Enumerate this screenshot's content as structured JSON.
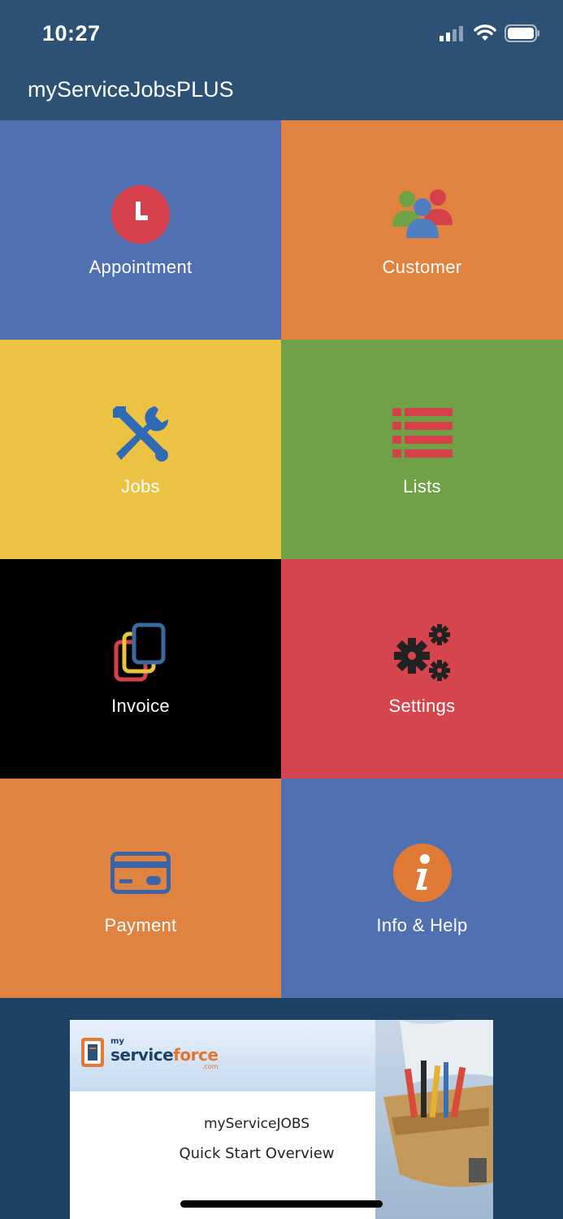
{
  "status": {
    "time": "10:27"
  },
  "header": {
    "title": "myServiceJobsPLUS"
  },
  "tiles": [
    {
      "label": "Appointment",
      "color": "#5170b2",
      "icon": "clock-icon"
    },
    {
      "label": "Customer",
      "color": "#e08240",
      "icon": "people-icon"
    },
    {
      "label": "Jobs",
      "color": "#ecc242",
      "icon": "tools-icon"
    },
    {
      "label": "Lists",
      "color": "#6fa247",
      "icon": "list-icon"
    },
    {
      "label": "Invoice",
      "color": "#000000",
      "icon": "documents-icon"
    },
    {
      "label": "Settings",
      "color": "#d6454d",
      "icon": "gears-icon"
    },
    {
      "label": "Payment",
      "color": "#e08240",
      "icon": "credit-card-icon"
    },
    {
      "label": "Info & Help",
      "color": "#5170b2",
      "icon": "info-icon"
    }
  ],
  "banner": {
    "logo_small": "my",
    "logo_main_a": "service",
    "logo_main_b": "force",
    "logo_dotcom": ".com",
    "line1": "myServiceJOBS",
    "line2": "Quick Start Overview"
  }
}
